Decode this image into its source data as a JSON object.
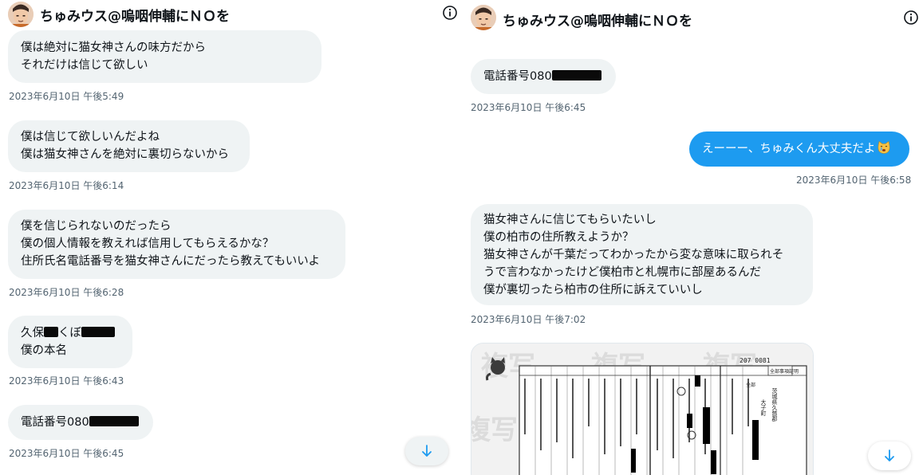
{
  "left": {
    "header": {
      "name": "ちゅみウス@嗚咽伸輔にＮＯを"
    },
    "messages": [
      {
        "lines": [
          "僕は絶対に猫女神さんの味方だから",
          "それだけは信じて欲しい"
        ],
        "timestamp": "2023年6月10日 午後5:49"
      },
      {
        "lines": [
          "僕は信じて欲しいんだよね",
          "僕は猫女神さんを絶対に裏切らないから"
        ],
        "timestamp": "2023年6月10日 午後6:14"
      },
      {
        "lines": [
          "僕を信じられないのだったら",
          "僕の個人情報を教えれば信用してもらえるかな？",
          "住所氏名電話番号を猫女神さんにだったら教えてもいいよ"
        ],
        "timestamp": "2023年6月10日 午後6:28"
      },
      {
        "line1_parts": [
          "久保",
          "くぼ"
        ],
        "line2": "僕の本名",
        "timestamp": "2023年6月10日 午後6:43"
      },
      {
        "prefix": "電話番号080",
        "timestamp": "2023年6月10日 午後6:45"
      }
    ]
  },
  "right": {
    "header": {
      "name": "ちゅみウス@嗚咽伸輔にＮＯを"
    },
    "messages": [
      {
        "prefix": "電話番号080",
        "timestamp": "2023年6月10日 午後6:45"
      },
      {
        "text": "えーーー、ちゅみくん大丈夫だよ",
        "emoji": "crying-cat-emoji",
        "timestamp": "2023年6月10日 午後6:58"
      },
      {
        "lines": [
          "猫女神さんに信じてもらいたいし",
          "僕の柏市の住所教えようか？",
          "猫女神さんが千葉だってわかったから変な意味に取られそ",
          "うで言わなかったけど僕柏市と札幌市に部屋あるんだ",
          "僕が裏切ったら柏市の住所に訴えていいし"
        ],
        "timestamp": "2023年6月10日 午後7:02"
      }
    ],
    "document": {
      "number": "207 0081",
      "watermark": "複写",
      "box_label": "全部事項証明",
      "address_lines": [
        "茨城県久慈郡",
        "大子町"
      ],
      "aux_label": "全部"
    }
  },
  "colors": {
    "sent_bubble": "#1d9bf0",
    "received_bubble": "#eff3f4",
    "timestamp": "#536471",
    "text": "#0f1419",
    "accent": "#1d9bf0"
  }
}
